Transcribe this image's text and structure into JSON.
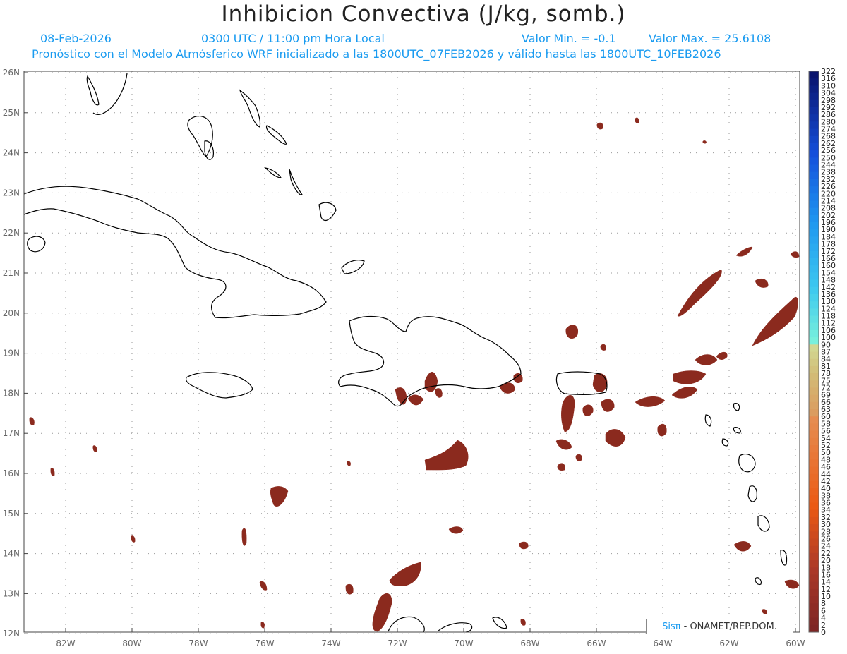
{
  "header": {
    "title": "Inhibicion Convectiva (J/kg, somb.)",
    "date": "08-Feb-2026",
    "time": "0300 UTC / 11:00 pm Hora Local",
    "val_min": "Valor Min. = -0.1",
    "val_max": "Valor Max. = 25.6108",
    "model_line": "Pronóstico con el Modelo Atmósferico WRF inicializado a las 1800UTC_07FEB2026 y válido hasta las  1800UTC_10FEB2026"
  },
  "map": {
    "lon_labels": [
      "82W",
      "80W",
      "78W",
      "76W",
      "74W",
      "72W",
      "70W",
      "68W",
      "66W",
      "64W",
      "62W",
      "60W"
    ],
    "lat_labels": [
      "26N",
      "25N",
      "24N",
      "23N",
      "22N",
      "21N",
      "20N",
      "19N",
      "18N",
      "17N",
      "16N",
      "15N",
      "14N",
      "13N",
      "12N"
    ],
    "field_color": "#8b2a1e",
    "coast_color": "#000000"
  },
  "colorbar": {
    "labels": [
      "322",
      "316",
      "310",
      "304",
      "298",
      "292",
      "286",
      "280",
      "274",
      "268",
      "262",
      "256",
      "250",
      "244",
      "238",
      "232",
      "226",
      "220",
      "214",
      "208",
      "202",
      "196",
      "190",
      "184",
      "178",
      "172",
      "166",
      "160",
      "154",
      "148",
      "142",
      "136",
      "130",
      "124",
      "118",
      "112",
      "106",
      "100",
      "90",
      "87",
      "84",
      "81",
      "78",
      "75",
      "72",
      "69",
      "66",
      "63",
      "60",
      "58",
      "56",
      "54",
      "52",
      "50",
      "48",
      "46",
      "44",
      "42",
      "40",
      "38",
      "36",
      "34",
      "32",
      "30",
      "28",
      "26",
      "24",
      "22",
      "20",
      "18",
      "16",
      "14",
      "12",
      "10",
      "8",
      "6",
      "4",
      "2",
      "0"
    ]
  },
  "credit": {
    "brand": "Sisπ",
    "text": "- ONAMET/REP.DOM."
  }
}
